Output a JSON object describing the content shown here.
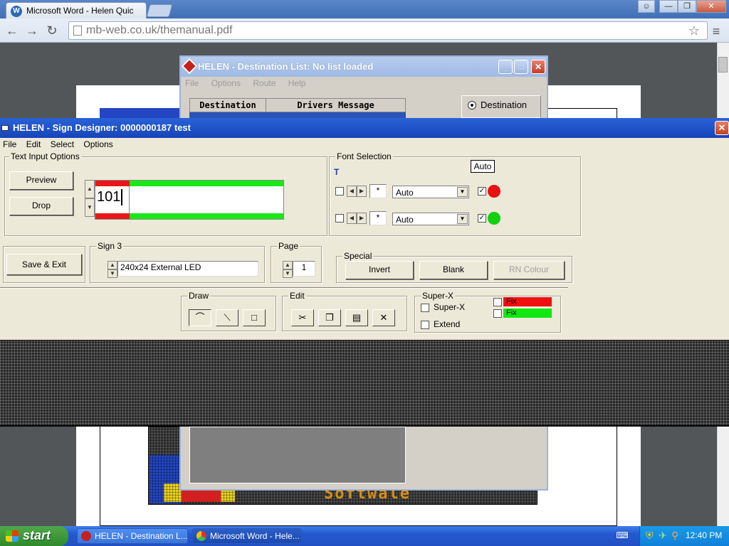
{
  "browser": {
    "tab_title": "Microsoft Word - Helen Quic",
    "url_scheme": "mb-web.co.uk/",
    "url_path": "themanual.pdf"
  },
  "pdf_led_text": "Softwale",
  "dest_window": {
    "title": "HELEN - Destination List: No list loaded",
    "menu": [
      "File",
      "Options",
      "Route",
      "Help"
    ],
    "col_destination": "Destination",
    "col_drivers_message": "Drivers Message",
    "radio_destination": "Destination"
  },
  "sign_window": {
    "title": "HELEN - Sign Designer: 0000000187 test",
    "menu": [
      "File",
      "Edit",
      "Select",
      "Options"
    ],
    "text_input_options": {
      "label": "Text Input Options",
      "preview": "Preview",
      "drop": "Drop",
      "text_value": "101"
    },
    "font_selection": {
      "label": "Font Selection",
      "auto_badge": "Auto",
      "row1": {
        "star": "*",
        "font": "Auto",
        "color": "#e81010"
      },
      "row2": {
        "star": "*",
        "font": "Auto",
        "color": "#10d010"
      }
    },
    "save_exit": "Save & Exit",
    "sign": {
      "label": "Sign 3",
      "value": "240x24 External LED"
    },
    "page": {
      "label": "Page",
      "value": "1"
    },
    "special": {
      "label": "Special",
      "invert": "Invert",
      "blank": "Blank",
      "rn_colour": "RN Colour"
    },
    "draw": {
      "label": "Draw"
    },
    "edit": {
      "label": "Edit"
    },
    "superx": {
      "label": "Super-X",
      "superx_chk": "Super-X",
      "extend_chk": "Extend",
      "fix_red": "Fix",
      "fix_green": "Fix"
    }
  },
  "taskbar": {
    "start": "start",
    "task1": "HELEN - Destination L...",
    "task2": "Microsoft Word - Hele...",
    "clock": "12:40 PM"
  }
}
